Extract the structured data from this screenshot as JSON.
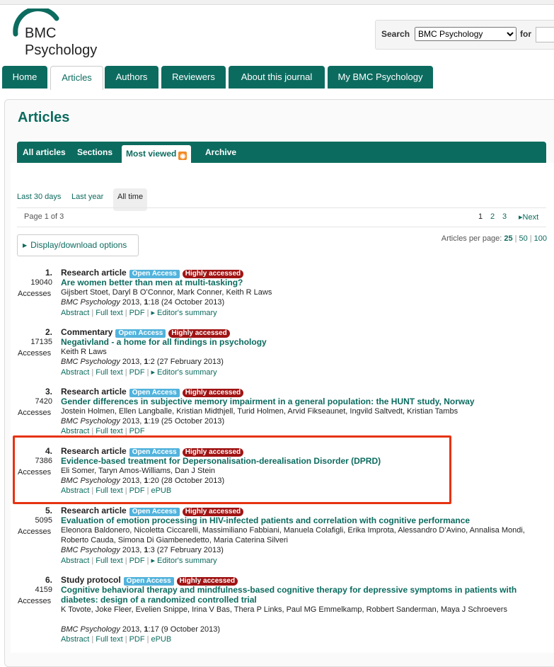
{
  "header": {
    "logo_line1": "BMC",
    "logo_line2": "Psychology",
    "search_label": "Search",
    "search_scope": "BMC Psychology",
    "for_label": "for"
  },
  "nav": {
    "tabs": [
      "Home",
      "Articles",
      "Authors",
      "Reviewers",
      "About this journal",
      "My BMC Psychology"
    ],
    "active": "Articles"
  },
  "page": {
    "title": "Articles",
    "subtabs": [
      "All articles",
      "Sections",
      "Most viewed",
      "Archive"
    ],
    "active_subtab": "Most viewed",
    "periods": [
      "Last 30 days",
      "Last year",
      "All time"
    ],
    "active_period": "All time",
    "page_of": "Page 1 of 3",
    "pages": [
      "1",
      "2",
      "3"
    ],
    "next_label": "Next",
    "download_label": "Display/download options",
    "per_page_label": "Articles per page:",
    "per_page_options": [
      "25",
      "50",
      "100"
    ]
  },
  "labels": {
    "accesses": "Accesses",
    "open_access": "Open Access",
    "highly_accessed": "Highly accessed",
    "abstract": "Abstract",
    "full_text": "Full text",
    "pdf": "PDF",
    "epub": "ePUB",
    "editors_summary": "Editor's summary"
  },
  "articles": [
    {
      "num": "1.",
      "accesses": "19040",
      "type": "Research article",
      "title": "Are women better than men at multi-tasking?",
      "authors": "Gijsbert Stoet, Daryl B O’Connor, Mark Conner, Keith R Laws",
      "journal": "BMC Psychology",
      "year": "2013,",
      "vol": "1",
      "ref": ":18 (24 October 2013)"
    },
    {
      "num": "2.",
      "accesses": "17135",
      "type": "Commentary",
      "title": "Negativland - a home for all findings in psychology",
      "authors": "Keith R Laws",
      "journal": "BMC Psychology",
      "year": "2013,",
      "vol": "1",
      "ref": ":2 (27 February 2013)"
    },
    {
      "num": "3.",
      "accesses": "7420",
      "type": "Research article",
      "title": "Gender differences in subjective memory impairment in a general population: the HUNT study, Norway",
      "authors": "Jostein Holmen, Ellen Langballe, Kristian Midthjell, Turid Holmen, Arvid Fikseaunet, Ingvild Saltvedt, Kristian Tambs",
      "journal": "BMC Psychology",
      "year": "2013,",
      "vol": "1",
      "ref": ":19 (25 October 2013)"
    },
    {
      "num": "4.",
      "accesses": "7386",
      "type": "Research article",
      "title": "Evidence-based treatment for Depersonalisation-derealisation Disorder (DPRD)",
      "authors": "Eli Somer, Taryn Amos-Williams, Dan J Stein",
      "journal": "BMC Psychology",
      "year": "2013,",
      "vol": "1",
      "ref": ":20 (28 October 2013)"
    },
    {
      "num": "5.",
      "accesses": "5095",
      "type": "Research article",
      "title": "Evaluation of emotion processing in HIV-infected patients and correlation with cognitive performance",
      "authors": "Eleonora Baldonero, Nicoletta Ciccarelli, Massimiliano Fabbiani, Manuela Colafigli, Erika Improta, Alessandro D’Avino, Annalisa Mondi, Roberto Cauda, Simona Di Giambenedetto, Maria Caterina Silveri",
      "journal": "BMC Psychology",
      "year": "2013,",
      "vol": "1",
      "ref": ":3 (27 February 2013)"
    },
    {
      "num": "6.",
      "accesses": "4159",
      "type": "Study protocol",
      "title": "Cognitive behavioral therapy and mindfulness-based cognitive therapy for depressive symptoms in patients with diabetes: design of a randomized controlled trial",
      "authors": "K Tovote, Joke Fleer, Evelien Snippe, Irina V Bas, Thera P Links, Paul MG Emmelkamp, Robbert Sanderman, Maya J Schroevers",
      "journal": "BMC Psychology",
      "year": "2013,",
      "vol": "1",
      "ref": ":17 (9 October 2013)"
    }
  ],
  "colors": {
    "brand": "#0c6b5f",
    "open_access": "#52b3dc",
    "highly_accessed": "#a01414",
    "highlight": "#e63312"
  }
}
